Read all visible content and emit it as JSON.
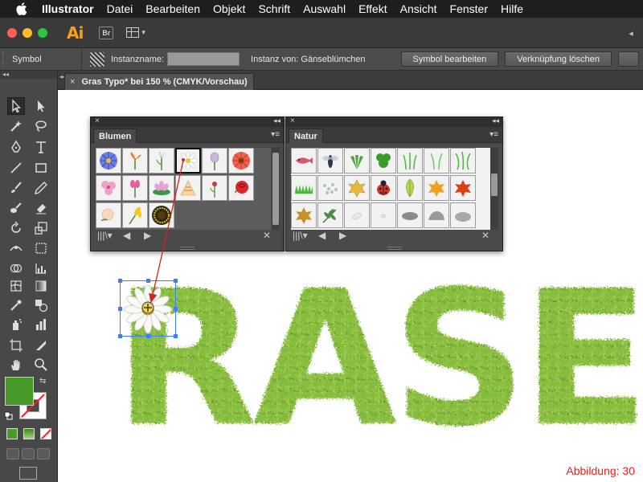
{
  "menubar": {
    "app_name": "Illustrator",
    "items": [
      "Datei",
      "Bearbeiten",
      "Objekt",
      "Schrift",
      "Auswahl",
      "Effekt",
      "Ansicht",
      "Fenster",
      "Hilfe"
    ]
  },
  "appbar": {
    "logo": "Ai",
    "bridge_label": "Br"
  },
  "control": {
    "type": "Symbol",
    "instance_label": "Instanzname:",
    "instance_value": "",
    "instance_of": "Instanz von: Gänseblümchen",
    "edit_button": "Symbol bearbeiten",
    "unlink_button": "Verknüpfung löschen"
  },
  "document": {
    "tab_title": "Gras Typo* bei 150 % (CMYK/Vorschau)",
    "close": "×"
  },
  "canvas": {
    "artwork_text": "RASEN",
    "caption": "Abbildung: 30"
  },
  "panels": {
    "blumen": {
      "tab": "Blumen"
    },
    "natur": {
      "tab": "Natur"
    }
  },
  "colors": {
    "fill": "#4a9a2a",
    "grass": "#7fb838",
    "selection": "#3d7ff0",
    "arrow": "#d0261c",
    "caption": "#e0241b"
  }
}
